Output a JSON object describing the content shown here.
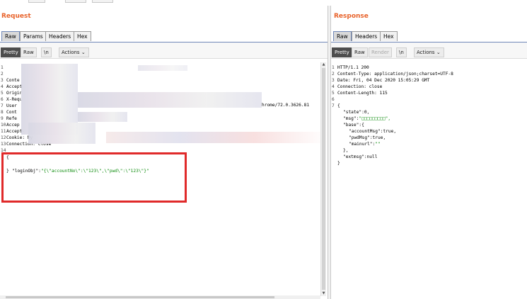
{
  "request": {
    "title": "Request",
    "tabs": [
      {
        "label": "Raw",
        "active": true
      },
      {
        "label": "Params",
        "active": false
      },
      {
        "label": "Headers",
        "active": false
      },
      {
        "label": "Hex",
        "active": false
      }
    ],
    "view": {
      "pretty": "Pretty",
      "raw": "Raw",
      "newline": "\\n",
      "actions": "Actions"
    },
    "lines": [
      {
        "n": "1",
        "text": ""
      },
      {
        "n": "2",
        "text": ""
      },
      {
        "n": "3",
        "text": "Conte"
      },
      {
        "n": "4",
        "text": "Accept"
      },
      {
        "n": "5",
        "text": "Origin"
      },
      {
        "n": "6",
        "text": "X-Requ"
      },
      {
        "n": "7",
        "text": "User"
      },
      {
        "n": "8",
        "text": "Cont"
      },
      {
        "n": "9",
        "text": "Refe"
      },
      {
        "n": "10",
        "text": "Accep"
      },
      {
        "n": "11",
        "text": "Accept-"
      },
      {
        "n": "12",
        "text": "Cookie: My"
      },
      {
        "n": "13",
        "text": "Connection: close"
      },
      {
        "n": "14",
        "text": ""
      }
    ],
    "user_agent_tail": "hrome/72.0.3626.81",
    "body": {
      "open": "{",
      "key": "\"loginObj\"",
      "colon": ":",
      "value": "\"{\\\"accountNo\\\":\\\"123\\\",\\\"pwd\\\":\\\"123\\\"}\"",
      "close": "}"
    }
  },
  "response": {
    "title": "Response",
    "tabs": [
      {
        "label": "Raw",
        "active": true
      },
      {
        "label": "Headers",
        "active": false
      },
      {
        "label": "Hex",
        "active": false
      }
    ],
    "view": {
      "pretty": "Pretty",
      "raw": "Raw",
      "render": "Render",
      "newline": "\\n",
      "actions": "Actions"
    },
    "headers": [
      {
        "n": "1",
        "text": "HTTP/1.1 200"
      },
      {
        "n": "2",
        "text": "Content-Type: application/json;charset=UTF-8"
      },
      {
        "n": "3",
        "text": "Date: Fri, 04 Dec 2020 15:05:29 GMT"
      },
      {
        "n": "4",
        "text": "Connection: close"
      },
      {
        "n": "5",
        "text": "Content-Length: 115"
      },
      {
        "n": "6",
        "text": ""
      },
      {
        "n": "7",
        "text": "{"
      }
    ],
    "json": [
      {
        "key": "\"state\"",
        "value": "0,",
        "indent": 1
      },
      {
        "key": "\"msg\"",
        "value": "\"□□□□□□□□□\",",
        "indent": 1,
        "green": true
      },
      {
        "key": "\"base\"",
        "value": "{",
        "indent": 1
      },
      {
        "key": "\"accountMsg\"",
        "value": "true,",
        "indent": 2
      },
      {
        "key": "\"pwdMsg\"",
        "value": "true,",
        "indent": 2
      },
      {
        "key": "\"mainurl\"",
        "value": "\"\"",
        "indent": 2,
        "green": true
      },
      {
        "key": "",
        "value": "},",
        "indent": 1
      },
      {
        "key": "\"extmsg\"",
        "value": "null",
        "indent": 1
      },
      {
        "key": "",
        "value": "}",
        "indent": 0
      }
    ]
  },
  "colors": {
    "title": "#e8632b",
    "tab_underline": "#7088b8",
    "json_string": "#0a8a0a",
    "highlight_box": "#e02a2a"
  },
  "icons": {
    "actions_chevron": "chevron-down-icon",
    "scroll_up": "arrow-up-icon",
    "scroll_down": "arrow-down-icon"
  }
}
